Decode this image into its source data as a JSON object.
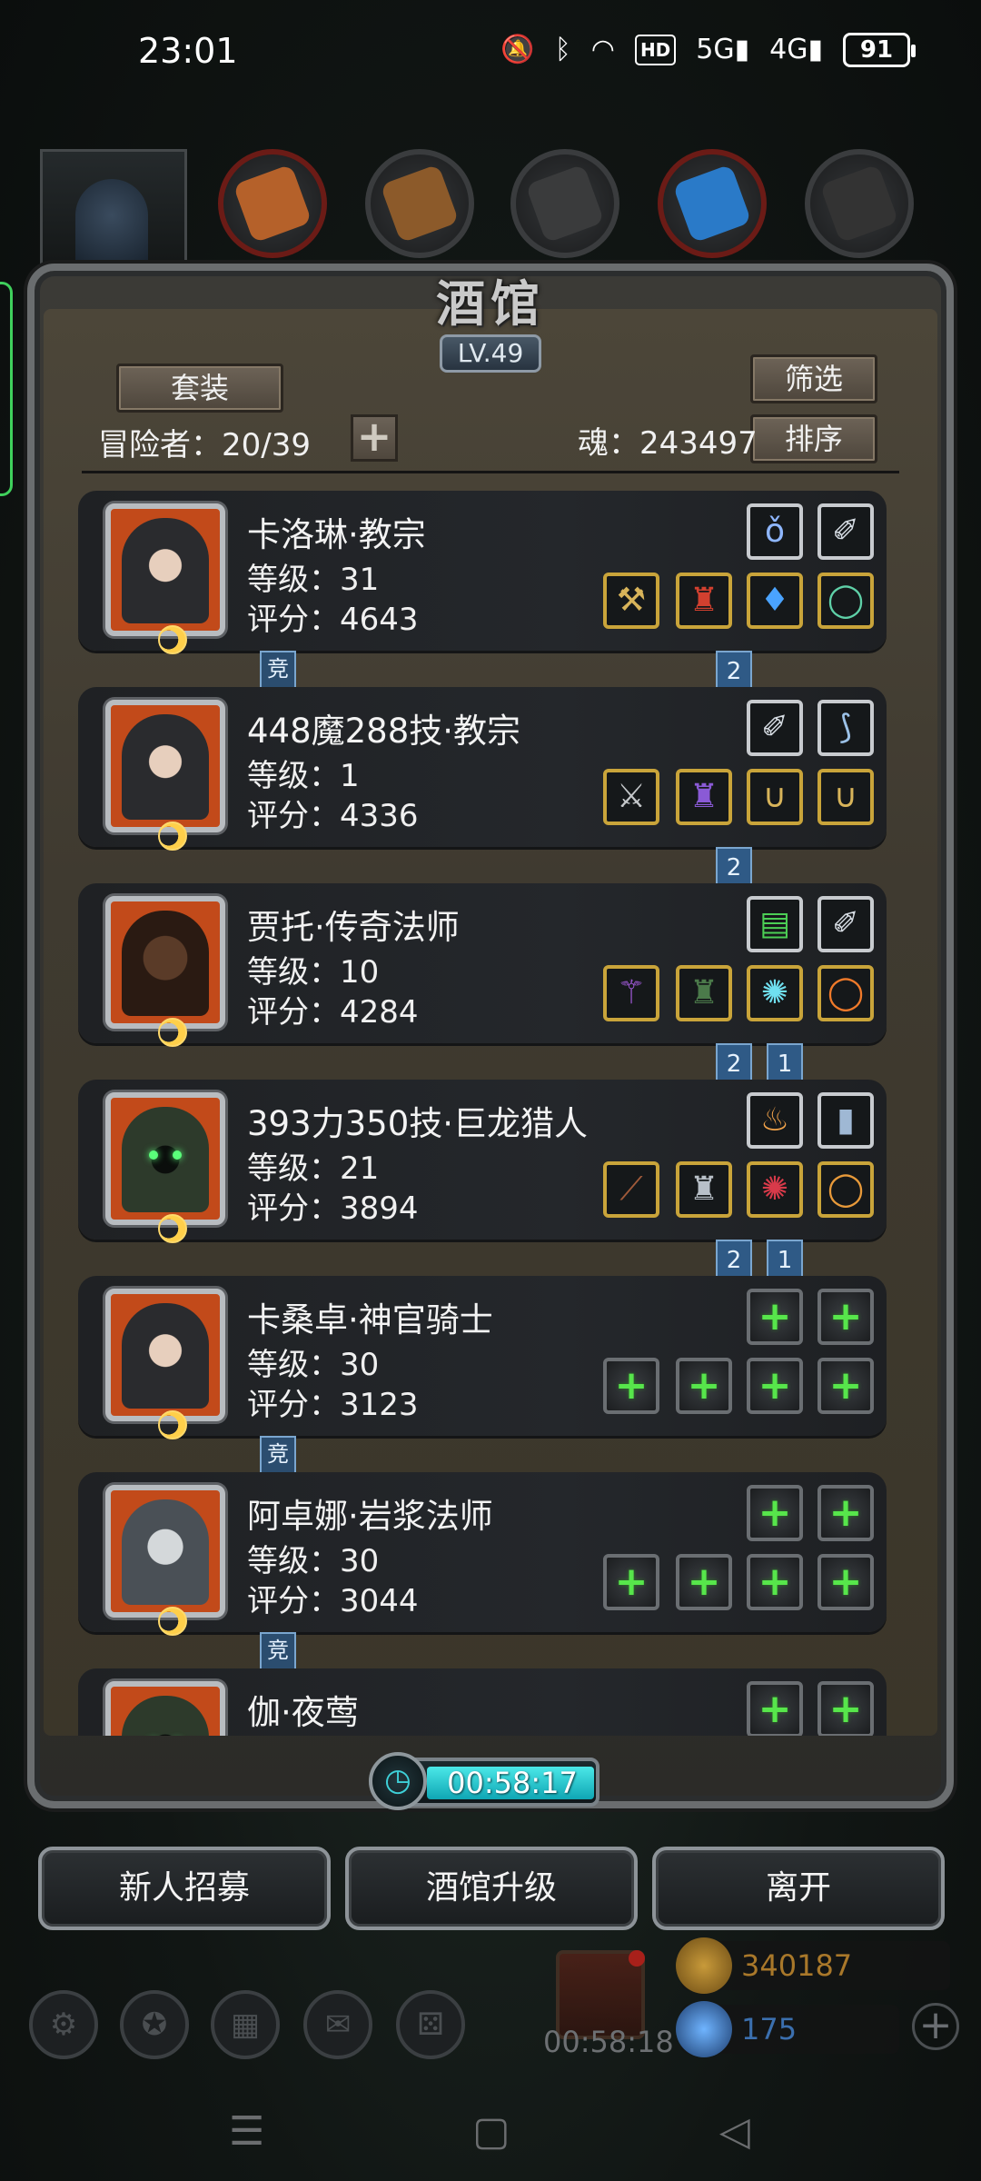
{
  "status_bar": {
    "time": "23:01",
    "icons": [
      "mute-icon",
      "bluetooth-icon",
      "wifi-icon",
      "hd-icon",
      "5g-signal-icon",
      "4g-signal-icon"
    ],
    "hd_label": "HD",
    "net1": "5G",
    "net2": "4G",
    "battery": "91"
  },
  "tavern": {
    "title": "酒馆",
    "level": "LV.49",
    "outfit_button": "套装",
    "filter_button": "筛选",
    "sort_button": "排序",
    "adventurers_label": "冒险者：20/39",
    "soul_label": "魂：243497",
    "add_button": "+"
  },
  "heroes": [
    {
      "name": "卡洛琳·教宗",
      "level": "等级：31",
      "score": "评分：4643",
      "portrait": "nun",
      "top_equips": [
        {
          "icon": "necklace-icon",
          "glyph": "ǒ",
          "frame": "silver",
          "color": "#8fb7ff"
        },
        {
          "icon": "feather-icon",
          "glyph": "✐",
          "frame": "silver",
          "color": "#d7dde4"
        }
      ],
      "bottom_equips": [
        {
          "icon": "hammer-icon",
          "glyph": "⚒",
          "frame": "gold",
          "color": "#d8b45a"
        },
        {
          "icon": "red-armor-icon",
          "glyph": "♜",
          "frame": "gold",
          "color": "#d2402f"
        },
        {
          "icon": "amulet-icon",
          "glyph": "♦",
          "frame": "gold",
          "color": "#4aa3ff"
        },
        {
          "icon": "ring-icon",
          "glyph": "◯",
          "frame": "gold",
          "color": "#5fd1a8"
        }
      ],
      "badge_left": "竞",
      "flags": [
        "2"
      ]
    },
    {
      "name": "448魔288技·教宗",
      "level": "等级：1",
      "score": "评分：4336",
      "portrait": "nun",
      "top_equips": [
        {
          "icon": "feather-icon",
          "glyph": "✐",
          "frame": "silver",
          "color": "#d7dde4"
        },
        {
          "icon": "bow-icon",
          "glyph": "⟆",
          "frame": "silver",
          "color": "#9cc2e8"
        }
      ],
      "bottom_equips": [
        {
          "icon": "axe-icon",
          "glyph": "⚔",
          "frame": "gold",
          "color": "#c4c7ca"
        },
        {
          "icon": "purple-armor-icon",
          "glyph": "♜",
          "frame": "gold",
          "color": "#8a5ad6"
        },
        {
          "icon": "chain-icon",
          "glyph": "∪",
          "frame": "gold",
          "color": "#d8b45a"
        },
        {
          "icon": "chain-icon",
          "glyph": "∪",
          "frame": "gold",
          "color": "#d8b45a"
        }
      ],
      "badge_left": "",
      "flags": [
        "2"
      ]
    },
    {
      "name": "贾托·传奇法师",
      "level": "等级：10",
      "score": "评分：4284",
      "portrait": "dark",
      "top_equips": [
        {
          "icon": "green-book-icon",
          "glyph": "▤",
          "frame": "silver",
          "color": "#4ccf55"
        },
        {
          "icon": "feather-icon",
          "glyph": "✐",
          "frame": "silver",
          "color": "#d7dde4"
        }
      ],
      "bottom_equips": [
        {
          "icon": "staff-icon",
          "glyph": "⚚",
          "frame": "gold",
          "color": "#a05ad8"
        },
        {
          "icon": "cloak-icon",
          "glyph": "♜",
          "frame": "gold",
          "color": "#4b7a4a"
        },
        {
          "icon": "cyan-amulet-icon",
          "glyph": "✺",
          "frame": "gold",
          "color": "#6fe0f0"
        },
        {
          "icon": "fire-ring-icon",
          "glyph": "◯",
          "frame": "gold",
          "color": "#f07a2a"
        }
      ],
      "badge_left": "",
      "flags": [
        "2",
        "1"
      ]
    },
    {
      "name": "393力350技·巨龙猎人",
      "level": "等级：21",
      "score": "评分：3894",
      "portrait": "hood",
      "top_equips": [
        {
          "icon": "lantern-icon",
          "glyph": "♨",
          "frame": "silver",
          "color": "#f0a24a"
        },
        {
          "icon": "tome-icon",
          "glyph": "▮",
          "frame": "silver",
          "color": "#9fb8d4"
        }
      ],
      "bottom_equips": [
        {
          "icon": "spear-icon",
          "glyph": "⟋",
          "frame": "gold",
          "color": "#a05a3a"
        },
        {
          "icon": "helm-armor-icon",
          "glyph": "♜",
          "frame": "gold",
          "color": "#b8c0c8"
        },
        {
          "icon": "ruby-amulet-icon",
          "glyph": "✺",
          "frame": "gold",
          "color": "#d83a4a"
        },
        {
          "icon": "gold-ring-icon",
          "glyph": "◯",
          "frame": "gold",
          "color": "#e89a3a"
        }
      ],
      "badge_left": "",
      "flags": [
        "2",
        "1"
      ]
    },
    {
      "name": "卡桑卓·神官骑士",
      "level": "等级：30",
      "score": "评分：3123",
      "portrait": "nun",
      "top_equips": [
        {
          "icon": "add-slot-icon",
          "glyph": "+",
          "frame": "empty",
          "color": ""
        },
        {
          "icon": "add-slot-icon",
          "glyph": "+",
          "frame": "empty",
          "color": ""
        }
      ],
      "bottom_equips": [
        {
          "icon": "add-slot-icon",
          "glyph": "+",
          "frame": "empty",
          "color": ""
        },
        {
          "icon": "add-slot-icon",
          "glyph": "+",
          "frame": "empty",
          "color": ""
        },
        {
          "icon": "add-slot-icon",
          "glyph": "+",
          "frame": "empty",
          "color": ""
        },
        {
          "icon": "add-slot-icon",
          "glyph": "+",
          "frame": "empty",
          "color": ""
        }
      ],
      "badge_left": "竞",
      "flags": []
    },
    {
      "name": "阿卓娜·岩浆法师",
      "level": "等级：30",
      "score": "评分：3044",
      "portrait": "pale",
      "top_equips": [
        {
          "icon": "add-slot-icon",
          "glyph": "+",
          "frame": "empty",
          "color": ""
        },
        {
          "icon": "add-slot-icon",
          "glyph": "+",
          "frame": "empty",
          "color": ""
        }
      ],
      "bottom_equips": [
        {
          "icon": "add-slot-icon",
          "glyph": "+",
          "frame": "empty",
          "color": ""
        },
        {
          "icon": "add-slot-icon",
          "glyph": "+",
          "frame": "empty",
          "color": ""
        },
        {
          "icon": "add-slot-icon",
          "glyph": "+",
          "frame": "empty",
          "color": ""
        },
        {
          "icon": "add-slot-icon",
          "glyph": "+",
          "frame": "empty",
          "color": ""
        }
      ],
      "badge_left": "竞",
      "flags": []
    },
    {
      "name": "伽·夜莺",
      "level": "",
      "score": "",
      "portrait": "hood",
      "top_equips": [
        {
          "icon": "add-slot-icon",
          "glyph": "+",
          "frame": "empty",
          "color": ""
        },
        {
          "icon": "add-slot-icon",
          "glyph": "+",
          "frame": "empty",
          "color": ""
        }
      ],
      "bottom_equips": [],
      "badge_left": "",
      "flags": []
    }
  ],
  "timer": "00:58:17",
  "actions": {
    "recruit": "新人招募",
    "upgrade": "酒馆升级",
    "leave": "离开"
  },
  "hud": {
    "gift_timer": "00:58:18",
    "gold": "340187",
    "gems": "175",
    "gold_color": "#a9782a",
    "gem_color": "#3b6fae"
  },
  "nav": {
    "menu": "☰",
    "home": "▢",
    "back": "◁"
  }
}
